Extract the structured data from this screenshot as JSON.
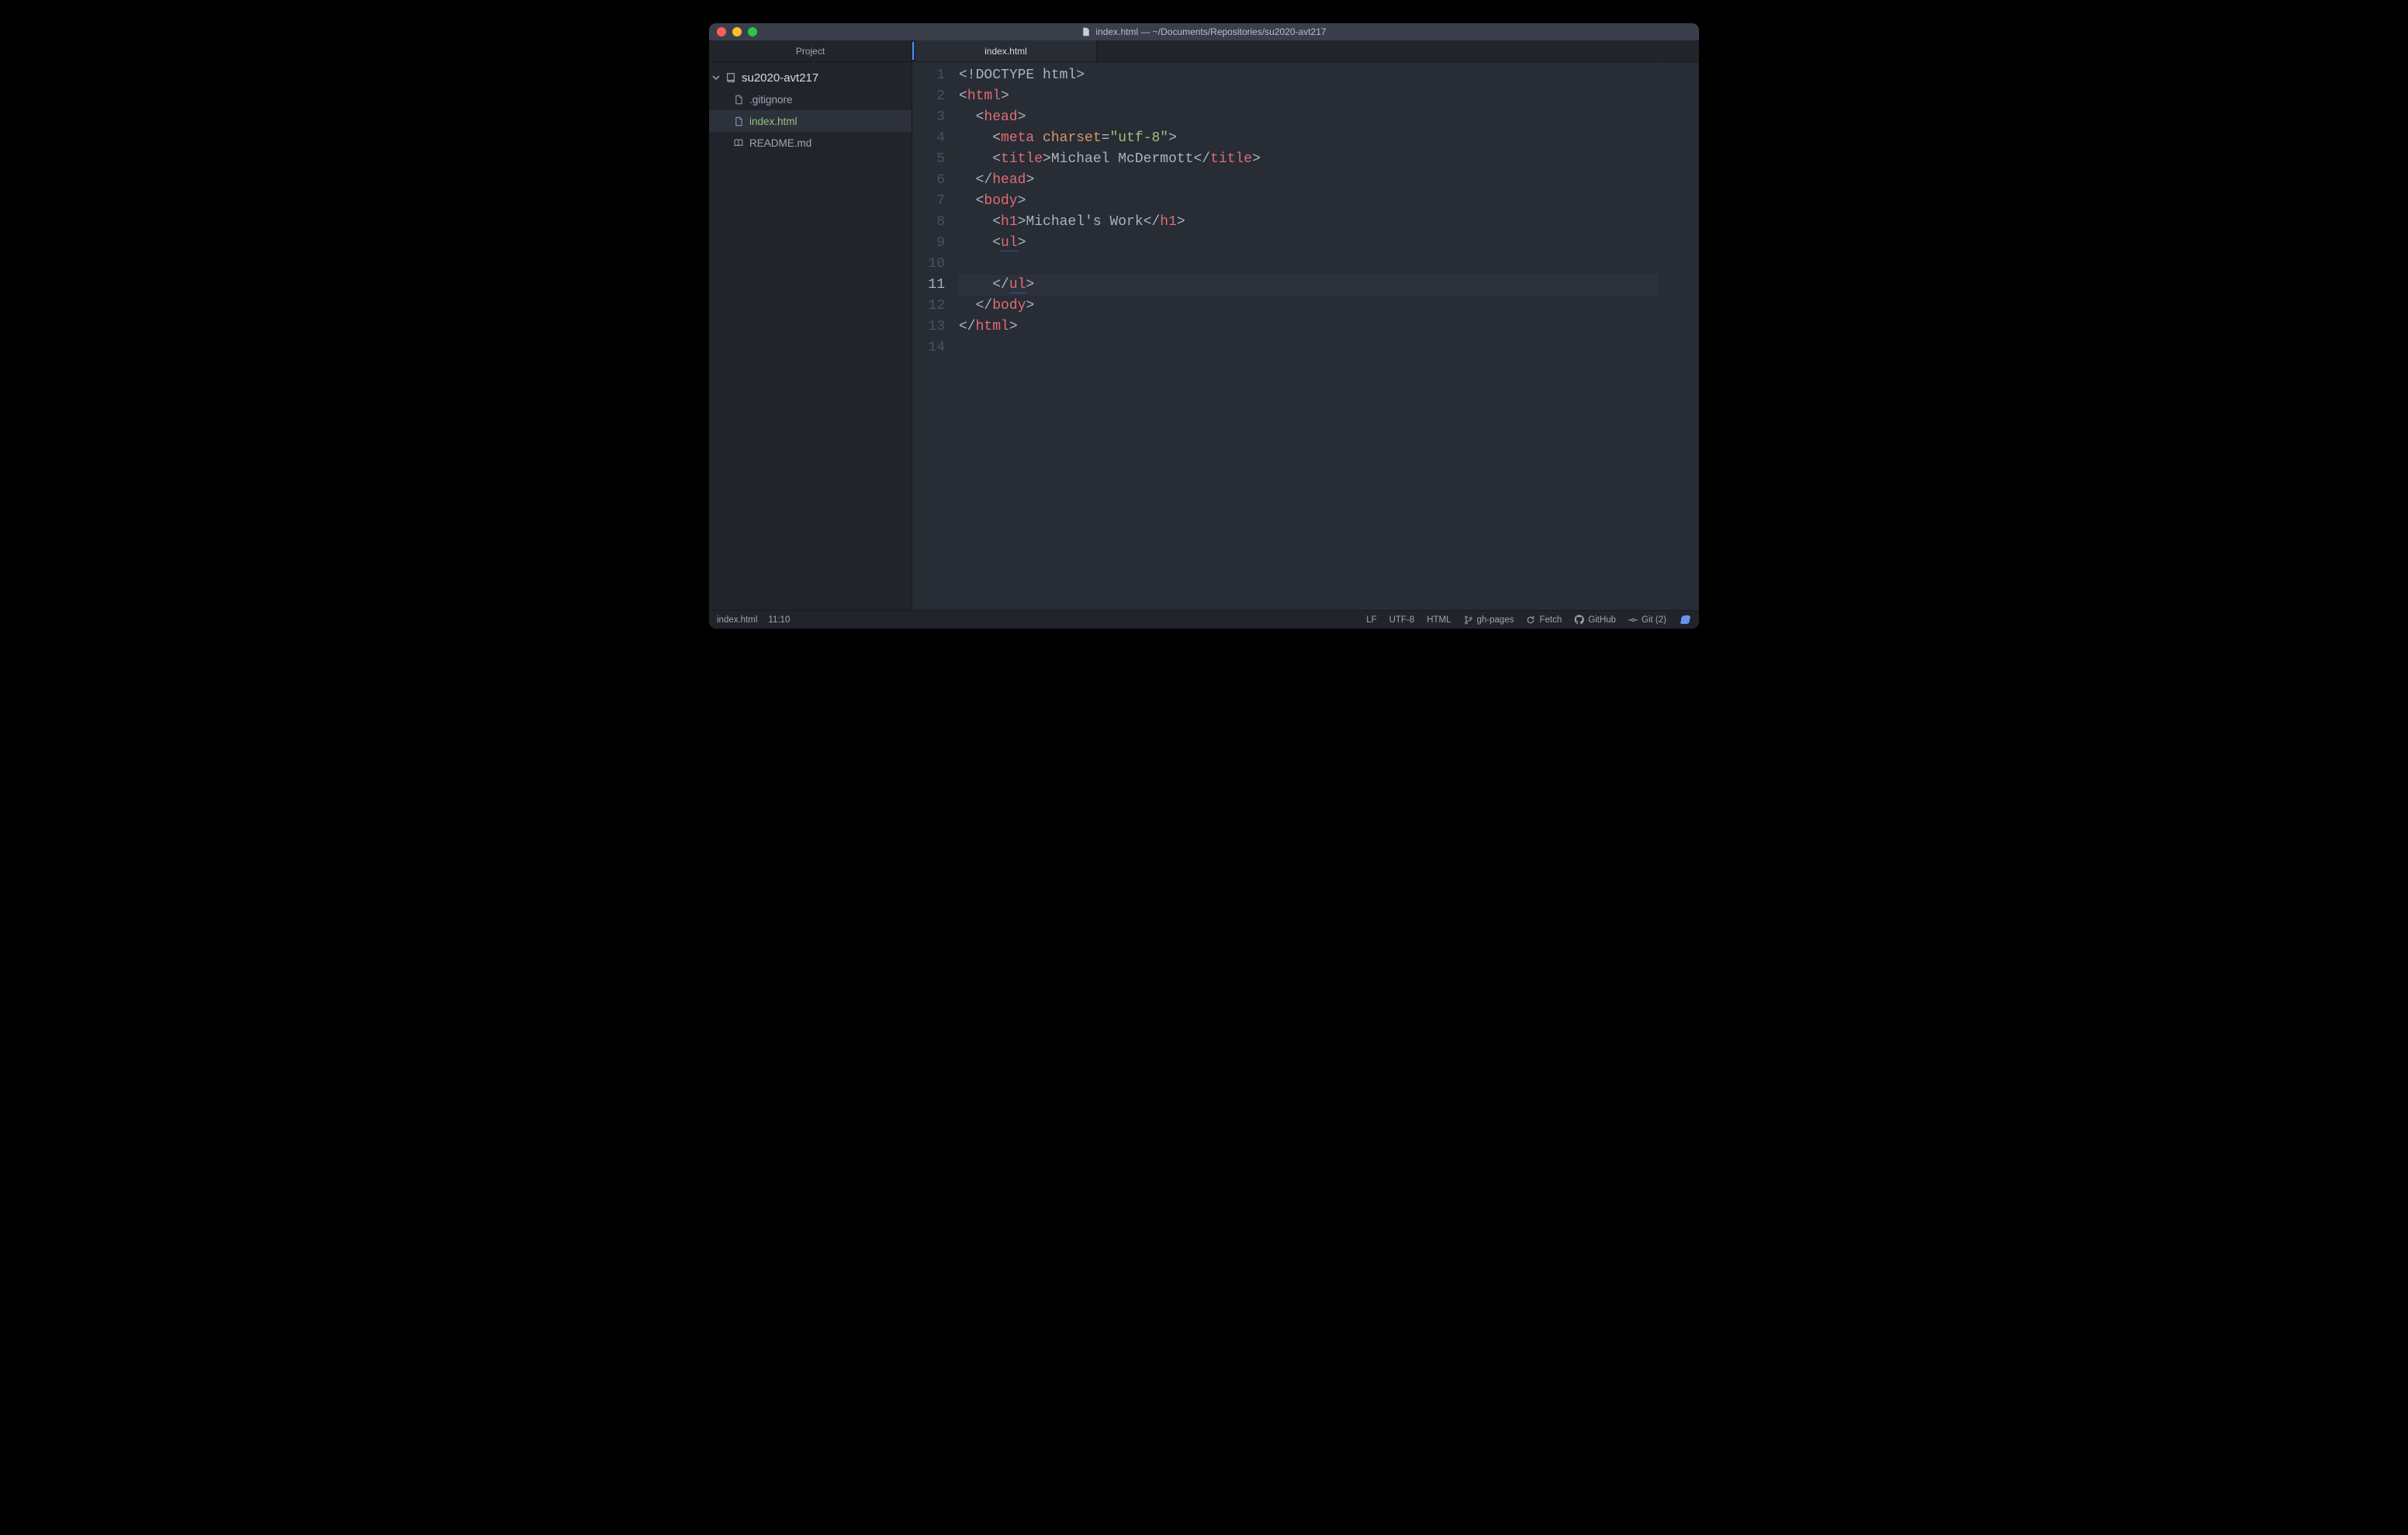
{
  "window": {
    "title": "index.html — ~/Documents/Repositories/su2020-avt217"
  },
  "sidebar": {
    "tab_label": "Project",
    "root": "su2020-avt217",
    "files": [
      {
        "name": ".gitignore",
        "icon": "file",
        "modified": false
      },
      {
        "name": "index.html",
        "icon": "file",
        "modified": true,
        "selected": true
      },
      {
        "name": "README.md",
        "icon": "book",
        "modified": false
      }
    ]
  },
  "tab": {
    "label": "index.html"
  },
  "code": {
    "current_line_index": 10,
    "lines": [
      [
        {
          "t": "<!",
          "c": "c-doc"
        },
        {
          "t": "DOCTYPE",
          "c": "c-doc"
        },
        {
          "t": " html>",
          "c": "c-doc"
        }
      ],
      [
        {
          "t": "<",
          "c": "c-punc"
        },
        {
          "t": "html",
          "c": "c-tag"
        },
        {
          "t": ">",
          "c": "c-punc"
        }
      ],
      [
        {
          "t": "  <",
          "c": "c-punc"
        },
        {
          "t": "head",
          "c": "c-tag"
        },
        {
          "t": ">",
          "c": "c-punc"
        }
      ],
      [
        {
          "t": "    <",
          "c": "c-punc"
        },
        {
          "t": "meta",
          "c": "c-tag"
        },
        {
          "t": " ",
          "c": "c-punc"
        },
        {
          "t": "charset",
          "c": "c-attr"
        },
        {
          "t": "=",
          "c": "c-punc"
        },
        {
          "t": "\"utf-8\"",
          "c": "c-str"
        },
        {
          "t": ">",
          "c": "c-punc"
        }
      ],
      [
        {
          "t": "    <",
          "c": "c-punc"
        },
        {
          "t": "title",
          "c": "c-tag"
        },
        {
          "t": ">",
          "c": "c-punc"
        },
        {
          "t": "Michael McDermott",
          "c": "c-text"
        },
        {
          "t": "</",
          "c": "c-punc"
        },
        {
          "t": "title",
          "c": "c-tag"
        },
        {
          "t": ">",
          "c": "c-punc"
        }
      ],
      [
        {
          "t": "  </",
          "c": "c-punc"
        },
        {
          "t": "head",
          "c": "c-tag"
        },
        {
          "t": ">",
          "c": "c-punc"
        }
      ],
      [
        {
          "t": "  <",
          "c": "c-punc"
        },
        {
          "t": "body",
          "c": "c-tag"
        },
        {
          "t": ">",
          "c": "c-punc"
        }
      ],
      [
        {
          "t": "    <",
          "c": "c-punc"
        },
        {
          "t": "h1",
          "c": "c-tag"
        },
        {
          "t": ">",
          "c": "c-punc"
        },
        {
          "t": "Michael's Work",
          "c": "c-text"
        },
        {
          "t": "</",
          "c": "c-punc"
        },
        {
          "t": "h1",
          "c": "c-tag"
        },
        {
          "t": ">",
          "c": "c-punc"
        }
      ],
      [
        {
          "t": "    <",
          "c": "c-punc"
        },
        {
          "t": "ul",
          "c": "c-tag underline"
        },
        {
          "t": ">",
          "c": "c-punc"
        }
      ],
      [
        {
          "t": "",
          "c": "c-text"
        }
      ],
      [
        {
          "t": "    </",
          "c": "c-punc"
        },
        {
          "t": "ul",
          "c": "c-tag underline"
        },
        {
          "t": ">",
          "c": "c-punc"
        }
      ],
      [
        {
          "t": "  </",
          "c": "c-punc"
        },
        {
          "t": "body",
          "c": "c-tag"
        },
        {
          "t": ">",
          "c": "c-punc"
        }
      ],
      [
        {
          "t": "</",
          "c": "c-punc"
        },
        {
          "t": "html",
          "c": "c-tag"
        },
        {
          "t": ">",
          "c": "c-punc"
        }
      ],
      [
        {
          "t": "",
          "c": "c-text"
        }
      ]
    ]
  },
  "status": {
    "file": "index.html",
    "cursor": "11:10",
    "line_ending": "LF",
    "encoding": "UTF-8",
    "grammar": "HTML",
    "branch": "gh-pages",
    "fetch": "Fetch",
    "github": "GitHub",
    "git": "Git (2)"
  }
}
